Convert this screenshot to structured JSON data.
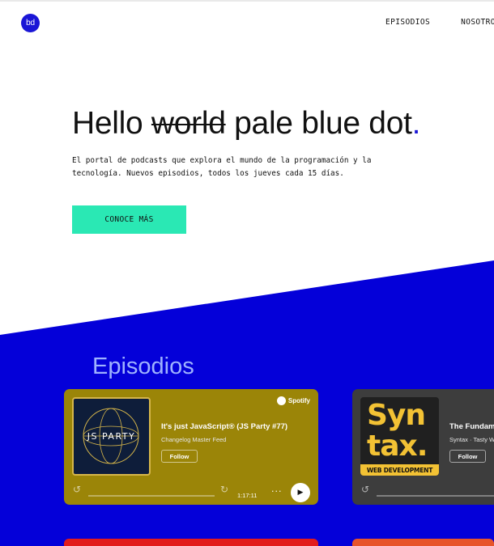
{
  "logo": {
    "text": "bd"
  },
  "nav": {
    "items": [
      {
        "label": "EPISODIOS"
      },
      {
        "label": "NOSOTROS"
      }
    ]
  },
  "hero": {
    "title_prefix": "Hello ",
    "title_struck": "world",
    "title_suffix": " pale blue dot",
    "title_dot": ".",
    "description": "El portal de podcasts que explora el mundo de la programación y la tecnología. Nuevos episodios, todos los jueves cada 15 días.",
    "cta_label": "CONOCE MÁS"
  },
  "episodes_section": {
    "title": "Episodios",
    "cards": [
      {
        "artwork_label": "JS PARTY",
        "provider": "Spotify",
        "title": "It's just JavaScript® (JS Party #77)",
        "show": "Changelog Master Feed",
        "follow_label": "Follow",
        "skip_back": "15",
        "skip_forward": "15",
        "duration": "1:17:11",
        "more": "···",
        "background": "#9b8508"
      },
      {
        "artwork_word1": "Syn",
        "artwork_word2": "tax.",
        "artwork_banner": "WEB DEVELOPMENT",
        "title": "The Fundam",
        "show": "Syntax · Tasty W",
        "follow_label": "Follow",
        "skip_back": "15",
        "background": "#3d3d3d"
      }
    ]
  },
  "colors": {
    "brand_blue": "#1a16d6",
    "accent_green": "#2ae8b4",
    "section_title": "#9fb3ff"
  }
}
